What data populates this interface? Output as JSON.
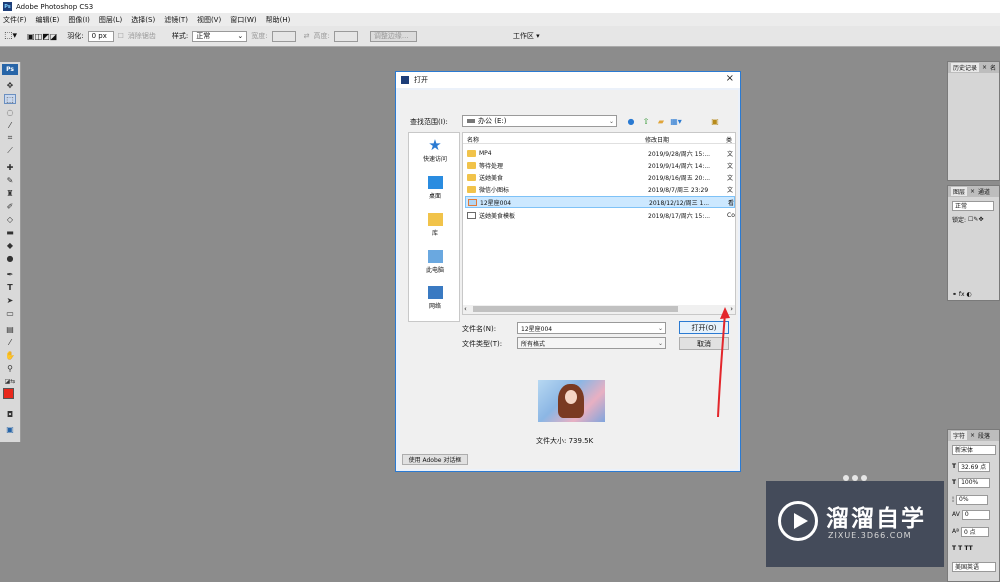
{
  "app": {
    "title": "Adobe Photoshop CS3",
    "logo": "Ps"
  },
  "menu": [
    "文件(F)",
    "编辑(E)",
    "图像(I)",
    "图层(L)",
    "选择(S)",
    "滤镜(T)",
    "视图(V)",
    "窗口(W)",
    "帮助(H)"
  ],
  "options": {
    "feather_label": "羽化:",
    "feather_value": "0 px",
    "antialias_label": "消除锯齿",
    "style_label": "样式:",
    "style_value": "正常",
    "width_label": "宽度:",
    "height_label": "高度:",
    "refine_label": "调整边缘...",
    "workspace_label": "工作区"
  },
  "panels": {
    "history": {
      "tab1": "历史记录",
      "tab2": "名"
    },
    "layers": {
      "tab1": "图层",
      "tab2": "通道",
      "blend": "正常",
      "lock_label": "锁定:"
    },
    "character": {
      "tab1": "字符",
      "tab2": "段落",
      "font": "新宋体",
      "size": "32.69 点",
      "scale": "100%",
      "tracking1": "0%",
      "tracking2": "0",
      "tracking3": "0 点",
      "lang": "美国英语"
    }
  },
  "dialog": {
    "title": "打开",
    "look_in_label": "查找范围(I):",
    "look_in_value": "办公 (E:)",
    "places": [
      "快速访问",
      "桌面",
      "库",
      "此电脑",
      "网络"
    ],
    "columns": {
      "name": "名称",
      "date": "修改日期",
      "type": "类"
    },
    "files": [
      {
        "name": "MP4",
        "date": "2019/9/28/周六 15:...",
        "type": "文"
      },
      {
        "name": "等待处理",
        "date": "2019/9/14/周六 14:...",
        "type": "文"
      },
      {
        "name": "送她美食",
        "date": "2019/8/16/周五 20:...",
        "type": "文"
      },
      {
        "name": "微信小图标",
        "date": "2019/8/7/周三 23:29",
        "type": "文"
      },
      {
        "name": "12星座004",
        "date": "2018/12/12/周三 1...",
        "type": "看"
      },
      {
        "name": "送她美食模板",
        "date": "2019/8/17/周六 15:...",
        "type": "Co"
      }
    ],
    "filename_label": "文件名(N):",
    "filename_value": "12星座004",
    "filetype_label": "文件类型(T):",
    "filetype_value": "所有格式",
    "open_button": "打开(O)",
    "cancel_button": "取消",
    "filesize": "文件大小: 739.5K",
    "adobe_dialog_button": "使用 Adobe 对话框"
  },
  "watermark": {
    "title": "溜溜自学",
    "url": "ZIXUE.3D66.COM"
  },
  "colors": {
    "foreground": "#e8281c",
    "background": "#ffffff",
    "accent": "#2a7ad2"
  }
}
